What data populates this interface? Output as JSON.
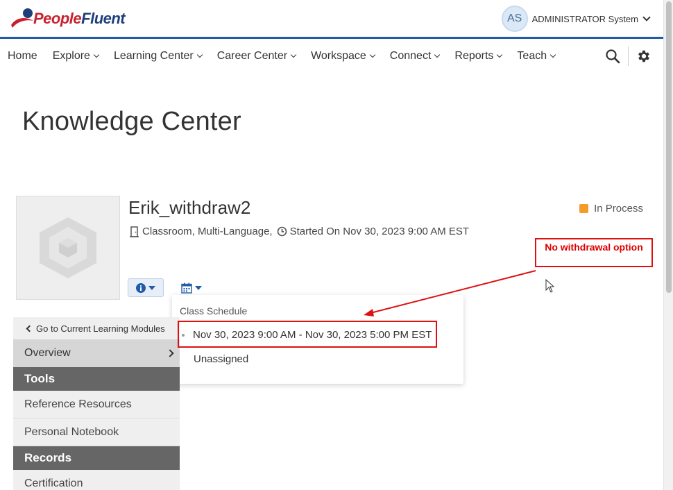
{
  "header": {
    "logo_text_a": "People",
    "logo_text_b": "Fluent",
    "user_initials": "AS",
    "user_name": "ADMINISTRATOR System"
  },
  "nav": {
    "items": [
      "Home",
      "Explore",
      "Learning Center",
      "Career Center",
      "Workspace",
      "Connect",
      "Reports",
      "Teach"
    ],
    "dropdown_flags": [
      false,
      true,
      true,
      true,
      true,
      true,
      true,
      true
    ],
    "tools": [
      "search-icon",
      "gear-icon"
    ]
  },
  "page": {
    "title": "Knowledge Center"
  },
  "course": {
    "title": "Erik_withdraw2",
    "type": "Classroom, Multi-Language,",
    "started": "Started On Nov 30, 2023 9:00 AM EST",
    "status": "In Process",
    "status_color": "#f39c2b"
  },
  "schedule_dropdown": {
    "header": "Class Schedule",
    "option_selected": "Nov 30, 2023 9:00 AM - Nov 30, 2023 5:00 PM EST",
    "option_other": "Unassigned"
  },
  "sidebar": {
    "go_back": "Go to Current Learning Modules",
    "overview": "Overview",
    "tools_header": "Tools",
    "tools_links": [
      "Reference Resources",
      "Personal Notebook"
    ],
    "records_header": "Records",
    "records_links": [
      "Certification"
    ]
  },
  "annotation": {
    "text": "No withdrawal option",
    "color": "#dd1111"
  },
  "colors": {
    "brand_blue": "#1f5da8",
    "brand_red": "#c8202e"
  }
}
